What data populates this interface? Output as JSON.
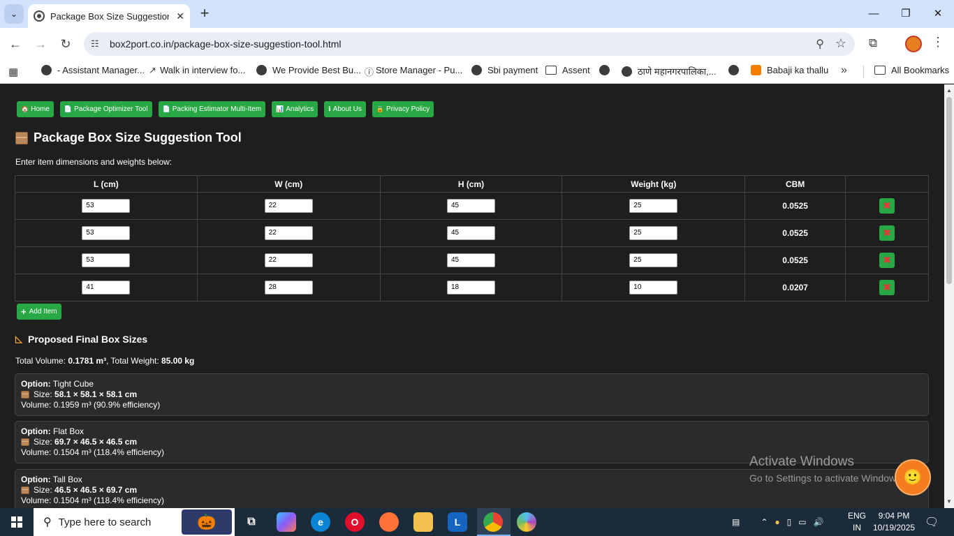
{
  "browser": {
    "tab_title": "Package Box Size Suggestion Tc",
    "url": "box2port.co.in/package-box-size-suggestion-tool.html",
    "bookmarks": [
      "- Assistant Manager...",
      "Walk in interview fo...",
      "We Provide Best Bu...",
      "Store Manager - Pu...",
      "Sbi payment",
      "Assent",
      "",
      "ठाणे महानगरपालिका,...",
      "",
      "Babaji ka thallu"
    ],
    "all_bookmarks": "All Bookmarks"
  },
  "nav": {
    "home": "Home",
    "optimizer": "Package Optimizer Tool",
    "estimator": "Packing Estimator Multi-Item",
    "analytics": "Analytics",
    "about": "About Us",
    "privacy": "Privacy Policy"
  },
  "page": {
    "title": "Package Box Size Suggestion Tool",
    "subtitle": "Enter item dimensions and weights below:",
    "columns": [
      "L (cm)",
      "W (cm)",
      "H (cm)",
      "Weight (kg)",
      "CBM",
      ""
    ],
    "rows": [
      {
        "l": "53",
        "w": "22",
        "h": "45",
        "weight": "25",
        "cbm": "0.0525"
      },
      {
        "l": "53",
        "w": "22",
        "h": "45",
        "weight": "25",
        "cbm": "0.0525"
      },
      {
        "l": "53",
        "w": "22",
        "h": "45",
        "weight": "25",
        "cbm": "0.0525"
      },
      {
        "l": "41",
        "w": "28",
        "h": "18",
        "weight": "10",
        "cbm": "0.0207"
      }
    ],
    "add_item": "Add Item",
    "section_title": "Proposed Final Box Sizes",
    "totals": {
      "volume_label": "Total Volume: ",
      "volume": "0.1781 m³",
      "weight_label": ", Total Weight: ",
      "weight": "85.00 kg"
    },
    "options": [
      {
        "label": "Option:",
        "name": "Tight Cube",
        "size_label": "Size: ",
        "size": "58.1 × 58.1 × 58.1 cm",
        "volume": "Volume: 0.1959 m³ (90.9% efficiency)"
      },
      {
        "label": "Option:",
        "name": "Flat Box",
        "size_label": "Size: ",
        "size": "69.7 × 46.5 × 46.5 cm",
        "volume": "Volume: 0.1504 m³ (118.4% efficiency)"
      },
      {
        "label": "Option:",
        "name": "Tall Box",
        "size_label": "Size: ",
        "size": "46.5 × 46.5 × 69.7 cm",
        "volume": "Volume: 0.1504 m³ (118.4% efficiency)"
      }
    ]
  },
  "overlay": {
    "activate_title": "Activate Windows",
    "activate_sub": "Go to Settings to activate Windows."
  },
  "taskbar": {
    "search_placeholder": "Type here to search",
    "lang": "ENG",
    "region": "IN",
    "time": "9:04 PM",
    "date": "10/19/2025"
  },
  "colors": {
    "accent_green": "#28a745",
    "page_bg": "#1e1e1e",
    "delete_x": "#e53935"
  }
}
